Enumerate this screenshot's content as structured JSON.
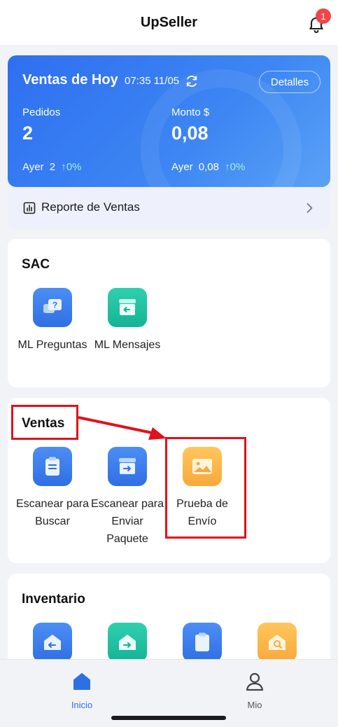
{
  "header": {
    "title": "UpSeller",
    "notification_count": "1"
  },
  "sales_today": {
    "title": "Ventas de Hoy",
    "time": "07:35 11/05",
    "details_button": "Detalles",
    "orders": {
      "label": "Pedidos",
      "value": "2",
      "yesterday_label": "Ayer",
      "yesterday_value": "2",
      "change": "↑0%"
    },
    "amount": {
      "label": "Monto $",
      "value": "0,08",
      "yesterday_label": "Ayer",
      "yesterday_value": "0,08",
      "change": "↑0%"
    },
    "report_label": "Reporte de Ventas"
  },
  "sections": {
    "sac": {
      "title": "SAC",
      "items": [
        {
          "label": "ML Preguntas",
          "icon": "question-chat-icon"
        },
        {
          "label": "ML Mensajes",
          "icon": "message-box-icon"
        }
      ]
    },
    "ventas": {
      "title": "Ventas",
      "items": [
        {
          "label": "Escanear para Buscar",
          "icon": "clipboard-icon"
        },
        {
          "label": "Escanear para Enviar Paquete",
          "icon": "box-send-icon"
        },
        {
          "label": "Prueba de Envío",
          "icon": "image-icon"
        }
      ]
    },
    "inventario": {
      "title": "Inventario",
      "items": [
        {
          "icon": "stock-in-icon"
        },
        {
          "icon": "stock-out-icon"
        },
        {
          "icon": "inventory-list-icon"
        },
        {
          "icon": "inventory-search-icon"
        }
      ]
    }
  },
  "bottom_nav": {
    "items": [
      {
        "label": "Inicio",
        "icon": "home-icon",
        "active": true
      },
      {
        "label": "Mio",
        "icon": "user-icon",
        "active": false
      }
    ]
  },
  "colors": {
    "accent": "#2f6fe4",
    "highlight": "#e0121b",
    "teal": "#14b395",
    "orange": "#f8a93a",
    "badge": "#f0454d"
  }
}
